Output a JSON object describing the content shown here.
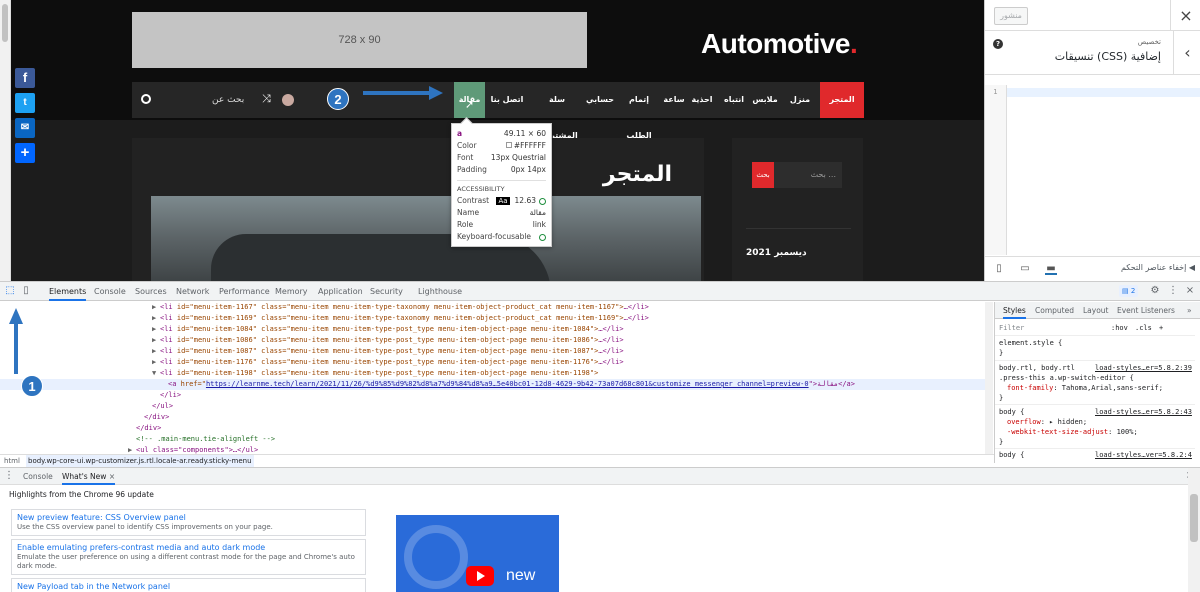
{
  "site": {
    "ad_label": "728 x 90",
    "logo_main": "Automotive",
    "logo_dot": ".",
    "nav_items": [
      "المتجر",
      "منزل",
      "ملابس",
      "انتباه",
      "احذية",
      "ساعة",
      "إتمام الطلب",
      "حسابي",
      "سلة المشتريات",
      "اتصل بنا",
      "مقالة"
    ],
    "nav_search": "بحث عن",
    "page_title": "المتجر",
    "side_search_placeholder": "بحث ...",
    "side_search_button": "بحث",
    "side_date": "ديسمبر 2021"
  },
  "markers": {
    "one": "1",
    "two": "2"
  },
  "tooltip": {
    "tag": "a",
    "size": "49.11 × 60",
    "color_label": "Color",
    "color_value": "#FFFFFF",
    "font_label": "Font",
    "font_value": "13px Questrial",
    "padding_label": "Padding",
    "padding_value": "0px 14px",
    "accessibility_label": "ACCESSIBILITY",
    "contrast_label": "Contrast",
    "contrast_aa": "Aa",
    "contrast_value": "12.63",
    "name_label": "Name",
    "name_value": "مقالة",
    "role_label": "Role",
    "role_value": "link",
    "kbd_label": "Keyboard-focusable"
  },
  "customizer": {
    "publish_label": "منشور",
    "header_sub": "تخصيص",
    "header_title": "تنسيقات (CSS) إضافية",
    "line_number": "1",
    "hide_controls": "إخفاء عناصر التحكم"
  },
  "devtools": {
    "tabs": [
      "Elements",
      "Console",
      "Sources",
      "Network",
      "Performance",
      "Memory",
      "Application",
      "Security",
      "Lighthouse"
    ],
    "issues_count": "2",
    "code_lines": [
      {
        "tri": "▶",
        "tag_open": "<li",
        "attrs": " id=\"menu-item-1167\" class=\"menu-item menu-item-type-taxonomy menu-item-object-product_cat menu-item-1167\">",
        "rest": "…</li>"
      },
      {
        "tri": "▶",
        "tag_open": "<li",
        "attrs": " id=\"menu-item-1169\" class=\"menu-item menu-item-type-taxonomy menu-item-object-product_cat menu-item-1169\">",
        "rest": "…</li>"
      },
      {
        "tri": "▶",
        "tag_open": "<li",
        "attrs": " id=\"menu-item-1084\" class=\"menu-item menu-item-type-post_type menu-item-object-page menu-item-1084\">",
        "rest": "…</li>"
      },
      {
        "tri": "▶",
        "tag_open": "<li",
        "attrs": " id=\"menu-item-1086\" class=\"menu-item menu-item-type-post_type menu-item-object-page menu-item-1086\">",
        "rest": "…</li>"
      },
      {
        "tri": "▶",
        "tag_open": "<li",
        "attrs": " id=\"menu-item-1087\" class=\"menu-item menu-item-type-post_type menu-item-object-page menu-item-1087\">",
        "rest": "…</li>"
      },
      {
        "tri": "▶",
        "tag_open": "<li",
        "attrs": " id=\"menu-item-1176\" class=\"menu-item menu-item-type-post_type menu-item-object-page menu-item-1176\">",
        "rest": "…</li>"
      },
      {
        "tri": "▼",
        "tag_open": "<li",
        "attrs": " id=\"menu-item-1198\" class=\"menu-item menu-item-type-post_type menu-item-object-page menu-item-1198\">",
        "rest": ""
      }
    ],
    "anchor_line": {
      "open": "<a",
      "attr": " href=\"",
      "href": "https://learnme.tech/learn/2021/11/26/%d9%85%d9%82%d8%a7%d9%84%d8%a9…5e40bc01-12d8-4629-9b42-73a07d68c801&customize_messenger_channel=preview-0",
      "close": "\">مقالة</a>"
    },
    "closing_lines": [
      "</li>",
      "</ul>",
      "</div>",
      "</div>",
      "<!-- .main-menu.tie-alignleft -->",
      "<ul class=\"components\">…</ul>"
    ],
    "breadcrumb": [
      "html",
      "body.wp-core-ui.wp-customizer.js.rtl.locale-ar.ready.sticky-menu"
    ],
    "style_tabs": [
      "Styles",
      "Computed",
      "Layout",
      "Event Listeners",
      "»"
    ],
    "styles": {
      "filter": "Filter",
      "hov": ":hov",
      "cls": ".cls",
      "plus": "+",
      "element_style": "element.style {",
      "close_brace": "}",
      "rule1_sel": "body.rtl, body.rtl",
      "rule1_sel2": ".press-this a.wp-switch-editor {",
      "rule1_src": "load-styles…er=5.8.2:39",
      "rule1_prop": "font-family",
      "rule1_val": "Tahoma,Arial,sans-serif;",
      "rule2_sel": "body {",
      "rule2_src": "load-styles…er=5.8.2:43",
      "rule2_prop1": "overflow",
      "rule2_val1": "▸ hidden;",
      "rule2_prop2": "-webkit-text-size-adjust",
      "rule2_val2": "100%;",
      "rule3_sel": "body {",
      "rule3_src": "load-styles…ver=5.8.2:4",
      "rule3_prop1": "background",
      "rule3_val1": "▸ #f0f0f1;",
      "rule3_prop2": "color",
      "rule3_val2": "#3c434a;"
    },
    "drawer_tabs": [
      "Console",
      "What's New"
    ],
    "drawer_heading": "Highlights from the Chrome 96 update",
    "cards": [
      {
        "title": "New preview feature: CSS Overview panel",
        "desc": "Use the CSS overview panel to identify CSS improvements on your page."
      },
      {
        "title": "Enable emulating prefers-contrast media and auto dark mode",
        "desc": "Emulate the user preference on using a different contrast mode for the page and Chrome's auto dark mode."
      },
      {
        "title": "New Payload tab in the Network panel",
        "desc": ""
      }
    ],
    "video_text": "new"
  },
  "colors": {
    "accent_red": "#e0292c",
    "highlight_green": "#5f9a79",
    "marker_blue": "#2e74c0",
    "devtools_blue": "#1a73e8"
  }
}
